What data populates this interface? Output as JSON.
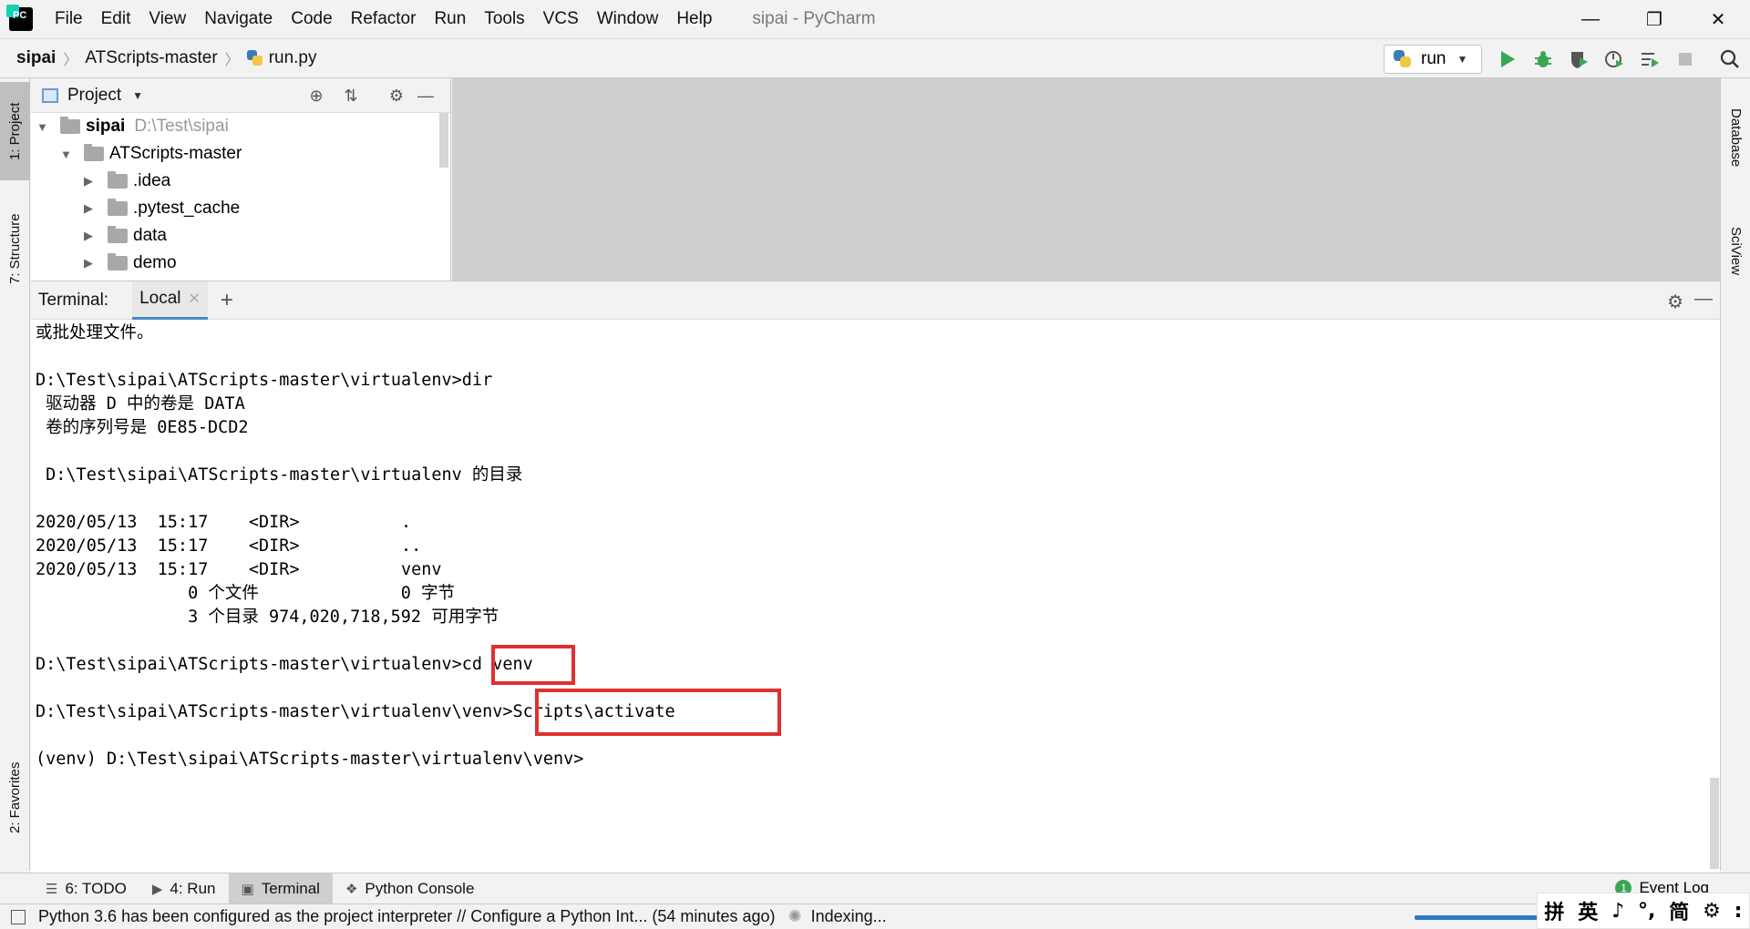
{
  "app": {
    "window_title": "sipai - PyCharm",
    "menu": [
      "File",
      "Edit",
      "View",
      "Navigate",
      "Code",
      "Refactor",
      "Run",
      "Tools",
      "VCS",
      "Window",
      "Help"
    ],
    "menu_mnemonics": [
      "F",
      "E",
      "V",
      "N",
      "C",
      "R",
      "u",
      "T",
      "S",
      "W",
      "H"
    ]
  },
  "breadcrumb": [
    "sipai",
    "ATScripts-master",
    "run.py"
  ],
  "run_config": {
    "label": "run"
  },
  "left_stripe": {
    "project": "1: Project",
    "structure": "7: Structure",
    "favorites": "2: Favorites"
  },
  "right_stripe": {
    "database": "Database",
    "sciview": "SciView"
  },
  "project_panel": {
    "title": "Project",
    "tree": [
      {
        "name": "sipai",
        "path": "D:\\Test\\sipai",
        "level": 0,
        "expanded": true
      },
      {
        "name": "ATScripts-master",
        "level": 1,
        "expanded": true
      },
      {
        "name": ".idea",
        "level": 2,
        "expanded": false
      },
      {
        "name": ".pytest_cache",
        "level": 2,
        "expanded": false
      },
      {
        "name": "data",
        "level": 2,
        "expanded": false
      },
      {
        "name": "demo",
        "level": 2,
        "expanded": false
      }
    ]
  },
  "terminal": {
    "label": "Terminal:",
    "tab": "Local",
    "lines": [
      "或批处理文件。",
      "",
      "D:\\Test\\sipai\\ATScripts-master\\virtualenv>dir",
      " 驱动器 D 中的卷是 DATA",
      " 卷的序列号是 0E85-DCD2",
      "",
      " D:\\Test\\sipai\\ATScripts-master\\virtualenv 的目录",
      "",
      "2020/05/13  15:17    <DIR>          .",
      "2020/05/13  15:17    <DIR>          ..",
      "2020/05/13  15:17    <DIR>          venv",
      "               0 个文件              0 字节",
      "               3 个目录 974,020,718,592 可用字节",
      "",
      "D:\\Test\\sipai\\ATScripts-master\\virtualenv>cd venv",
      "",
      "D:\\Test\\sipai\\ATScripts-master\\virtualenv\\venv>Scripts\\activate",
      "",
      "(venv) D:\\Test\\sipai\\ATScripts-master\\virtualenv\\venv>"
    ]
  },
  "tool_tabs": [
    {
      "label": "6: TODO"
    },
    {
      "label": "4: Run"
    },
    {
      "label": "Terminal"
    },
    {
      "label": "Python Console"
    }
  ],
  "event_log": {
    "label": "Event Log",
    "count": "1"
  },
  "status": {
    "message": "Python 3.6 has been configured as the project interpreter // Configure a Python Int... (54 minutes ago)",
    "indexing": "Indexing..."
  },
  "ime": [
    "拼",
    "英",
    "♪",
    "°,",
    "简",
    "⚙",
    ":"
  ],
  "colors": {
    "accent": "#4a88c7",
    "highlight_box": "#e03030",
    "run_green": "#3aa655"
  }
}
